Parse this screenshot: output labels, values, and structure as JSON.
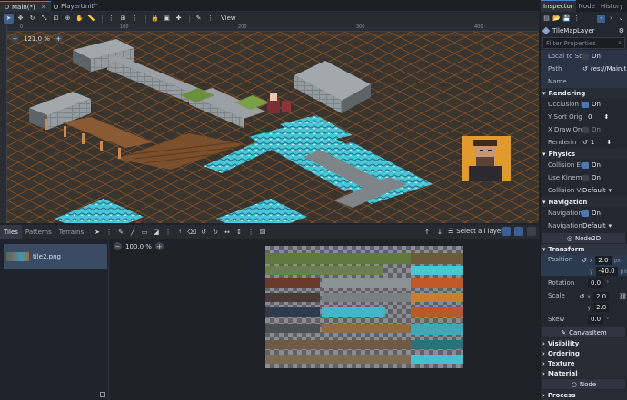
{
  "tabs": [
    {
      "label": "Main(*)",
      "active": true
    },
    {
      "label": "PlayerUnit",
      "active": false
    }
  ],
  "add_tab": "+",
  "toolbar": {
    "view_label": "View"
  },
  "viewport": {
    "zoom": "121.0 %",
    "ruler_marks": [
      "0",
      "100",
      "200",
      "300",
      "400"
    ]
  },
  "bottom_panel": {
    "tabs": [
      "Tiles",
      "Patterns",
      "Terrains"
    ],
    "select_all": "Select all layers",
    "tile_source": "tile2.png",
    "atlas_zoom": "100.0 %"
  },
  "inspector": {
    "tabs": [
      "Inspector",
      "Node",
      "History"
    ],
    "node_name": "TileMapLayer",
    "filter_placeholder": "Filter Properties",
    "props_top": [
      {
        "label": "Local to Sce",
        "value": "On",
        "checked": false
      },
      {
        "label": "Path",
        "value": "res://Main.t"
      },
      {
        "label": "Name",
        "value": ""
      }
    ],
    "rendering": {
      "title": "Rendering",
      "occlusion": {
        "label": "Occlusion E",
        "value": "On"
      },
      "ysort": {
        "label": "Y Sort Origi",
        "value": "0"
      },
      "xdraw": {
        "label": "X Draw Orde",
        "value": "On"
      },
      "render": {
        "label": "Renderin",
        "value": "1"
      }
    },
    "physics": {
      "title": "Physics",
      "collision": {
        "label": "Collision En",
        "value": "On"
      },
      "kinematic": {
        "label": "Use Kinema",
        "value": "On"
      },
      "visibility": {
        "label": "Collision Visi",
        "value": "Default"
      }
    },
    "navigation": {
      "title": "Navigation",
      "nav_enabled": {
        "label": "Navigation E",
        "value": "On"
      },
      "nav_mode": {
        "label": "Navigation",
        "value": "Default"
      }
    },
    "node2d": "Node2D",
    "transform": {
      "title": "Transform",
      "position": {
        "label": "Position",
        "x": "2.0",
        "y": "-40.0",
        "unit": "px"
      },
      "rotation": {
        "label": "Rotation",
        "value": "0.0",
        "unit": "°"
      },
      "scale": {
        "label": "Scale",
        "x": "2.0",
        "y": "2.0"
      },
      "skew": {
        "label": "Skew",
        "value": "0.0",
        "unit": "°"
      }
    },
    "canvasitem": "CanvasItem",
    "collapsed": [
      "Visibility",
      "Ordering",
      "Texture",
      "Material"
    ],
    "node": "Node",
    "process": "Process"
  },
  "colors": {
    "accent": "#4d7ec1",
    "grid_line": "#c8691e",
    "water": "#49c7d6"
  }
}
